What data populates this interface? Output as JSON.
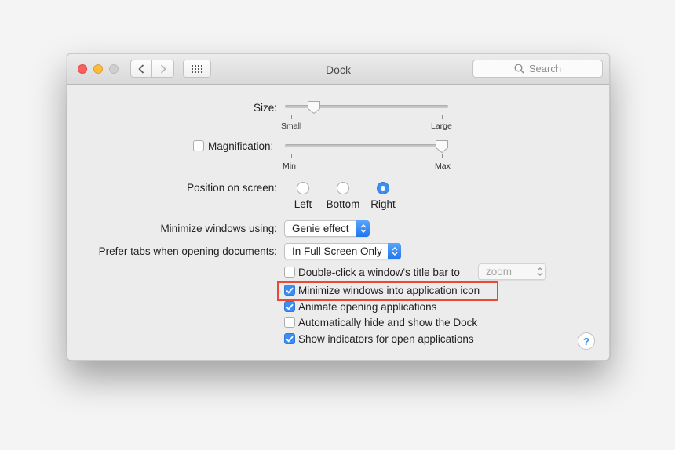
{
  "window": {
    "title": "Dock",
    "search_placeholder": "Search"
  },
  "size": {
    "label": "Size:",
    "min_label": "Small",
    "max_label": "Large",
    "value": 0.15
  },
  "magnification": {
    "label": "Magnification:",
    "checked": false,
    "min_label": "Min",
    "max_label": "Max",
    "value": 1.0
  },
  "position": {
    "label": "Position on screen:",
    "options": [
      "Left",
      "Bottom",
      "Right"
    ],
    "selected": "Right"
  },
  "minimize_using": {
    "label": "Minimize windows using:",
    "value": "Genie effect"
  },
  "prefer_tabs": {
    "label": "Prefer tabs when opening documents:",
    "value": "In Full Screen Only"
  },
  "checkboxes": [
    {
      "label": "Double-click a window's title bar to",
      "checked": false
    },
    {
      "label": "Minimize windows into application icon",
      "checked": true
    },
    {
      "label": "Animate opening applications",
      "checked": true
    },
    {
      "label": "Automatically hide and show the Dock",
      "checked": false
    },
    {
      "label": "Show indicators for open applications",
      "checked": true
    }
  ],
  "double_click_action": {
    "value": "zoom"
  },
  "help": {
    "label": "?"
  },
  "colors": {
    "accent": "#3b8ff2",
    "highlight_box": "#ea4a33"
  }
}
